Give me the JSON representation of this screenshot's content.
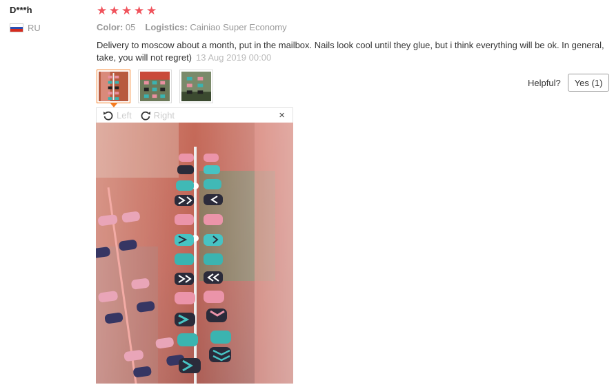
{
  "reviewer": {
    "name": "D***h",
    "country": "RU",
    "flag_colors": [
      "#ffffff",
      "#2b4fb3",
      "#d52b1e"
    ]
  },
  "rating": {
    "stars": 5,
    "max": 5,
    "color": "#f0535c"
  },
  "meta": {
    "color_label": "Color:",
    "color_value": "05",
    "logistics_label": "Logistics:",
    "logistics_value": "Cainiao Super Economy"
  },
  "review": {
    "text": "Delivery to moscow about a month, put in the mailbox. Nails look cool until they glue, but i think everything will be ok. In general, take, you will not regret)",
    "date": "13 Aug 2019 00:00"
  },
  "thumbnails": [
    {
      "name": "review-photo-1",
      "active": true
    },
    {
      "name": "review-photo-2",
      "active": false
    },
    {
      "name": "review-photo-3",
      "active": false
    }
  ],
  "helpful": {
    "label": "Helpful?",
    "yes_label": "Yes (1)"
  },
  "viewer": {
    "rotate_left_label": "Left",
    "rotate_right_label": "Right",
    "close_symbol": "×"
  },
  "accent_color": "#f57c20"
}
